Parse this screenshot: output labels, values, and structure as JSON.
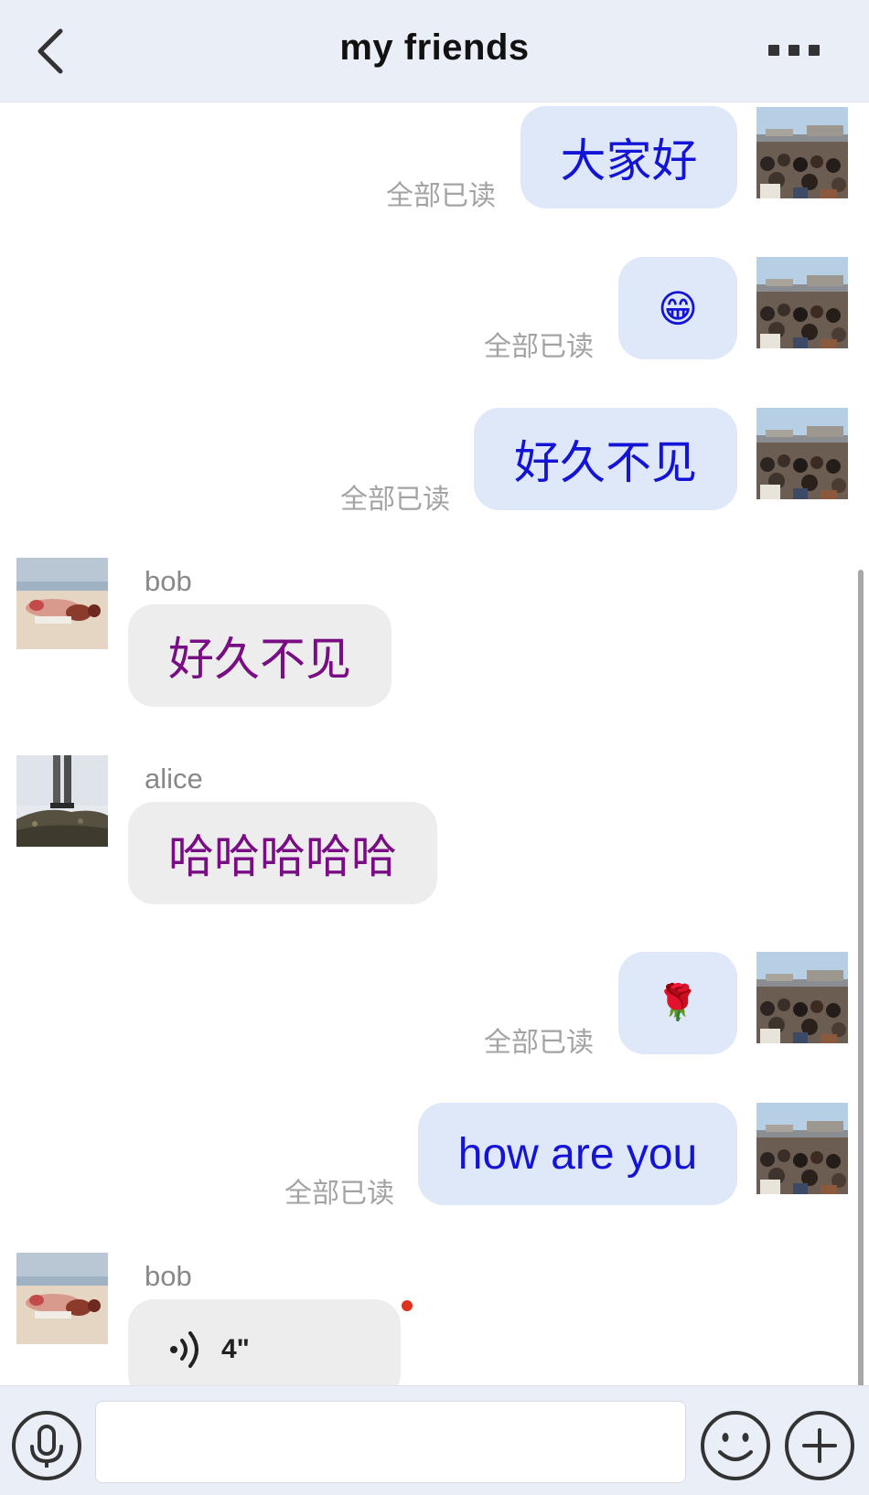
{
  "header": {
    "title": "my friends",
    "back_icon": "chevron-left-icon",
    "more_icon": "more-dots-icon"
  },
  "messages": [
    {
      "direction": "out",
      "type": "text",
      "text": "大家好",
      "read_status": "全部已读"
    },
    {
      "direction": "out",
      "type": "emoji",
      "emoji": "😁",
      "read_status": "全部已读"
    },
    {
      "direction": "out",
      "type": "text",
      "text": "好久不见",
      "read_status": "全部已读"
    },
    {
      "direction": "in",
      "type": "text",
      "sender": "bob",
      "text": "好久不见"
    },
    {
      "direction": "in",
      "type": "text",
      "sender": "alice",
      "text": "哈哈哈哈哈"
    },
    {
      "direction": "out",
      "type": "emoji",
      "emoji": "🌹",
      "read_status": "全部已读"
    },
    {
      "direction": "out",
      "type": "text",
      "text": "how are you",
      "read_status": "全部已读"
    },
    {
      "direction": "in",
      "type": "voice",
      "sender": "bob",
      "duration": "4\"",
      "unread": true
    }
  ],
  "input_bar": {
    "text_value": "",
    "mic_icon": "microphone-icon",
    "emoji_icon": "smiley-icon",
    "plus_icon": "plus-circle-icon"
  },
  "colors": {
    "header_bg": "#eaeef6",
    "outgoing_bubble_bg": "#dfe8f8",
    "outgoing_text": "#1414d6",
    "incoming_bubble_bg": "#ededed",
    "incoming_text": "#780d84",
    "read_status_text": "#a3a3a3",
    "unread_dot": "#e0301e"
  }
}
